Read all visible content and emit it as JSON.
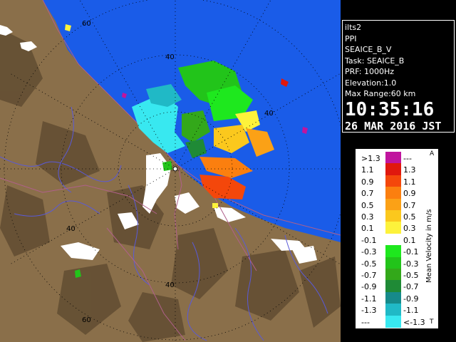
{
  "map": {
    "ring_labels": [
      "60",
      "40",
      "40",
      "40",
      "40",
      "60"
    ],
    "colors": {
      "sea": "#1a5ce8",
      "land": "#8a6f4a",
      "land_dark": "#4b3a24",
      "snow": "#ffffff",
      "rivers": "#5a5ad8",
      "roads": "#b0608a"
    }
  },
  "info": {
    "radar": "ilts2",
    "product": "PPI",
    "scan": "SEAICE_B_V",
    "task": "Task: SEAICE_B",
    "prf": "PRF: 1000Hz",
    "elevation": "Elevation:1.0",
    "max_range": "Max Range:60 km",
    "time": "10:35:16",
    "date": "26 MAR 2016 JST"
  },
  "scale": {
    "title": "Mean Velocity in m/s",
    "top_marker": "A",
    "bottom_marker": "T",
    "rows": [
      {
        "lo": ">1.3",
        "hi": "---",
        "color": "#c0159e"
      },
      {
        "lo": "1.1",
        "hi": "1.3",
        "color": "#e0180e"
      },
      {
        "lo": "0.9",
        "hi": "1.1",
        "color": "#f4470b"
      },
      {
        "lo": "0.7",
        "hi": "0.9",
        "color": "#fb7f0f"
      },
      {
        "lo": "0.5",
        "hi": "0.7",
        "color": "#fba116"
      },
      {
        "lo": "0.3",
        "hi": "0.5",
        "color": "#fbc81d"
      },
      {
        "lo": "0.1",
        "hi": "0.3",
        "color": "#fdf23b"
      },
      {
        "lo": "-0.1",
        "hi": "0.1",
        "color": "#ffffff"
      },
      {
        "lo": "-0.3",
        "hi": "-0.1",
        "color": "#1ee81e"
      },
      {
        "lo": "-0.5",
        "hi": "-0.3",
        "color": "#22c41a"
      },
      {
        "lo": "-0.7",
        "hi": "-0.5",
        "color": "#33a81a"
      },
      {
        "lo": "-0.9",
        "hi": "-0.7",
        "color": "#1f8a36"
      },
      {
        "lo": "-1.1",
        "hi": "-0.9",
        "color": "#168a8a"
      },
      {
        "lo": "-1.3",
        "hi": "-1.1",
        "color": "#20b9c6"
      },
      {
        "lo": "---",
        "hi": "<-1.3",
        "color": "#38e8f0"
      }
    ]
  }
}
